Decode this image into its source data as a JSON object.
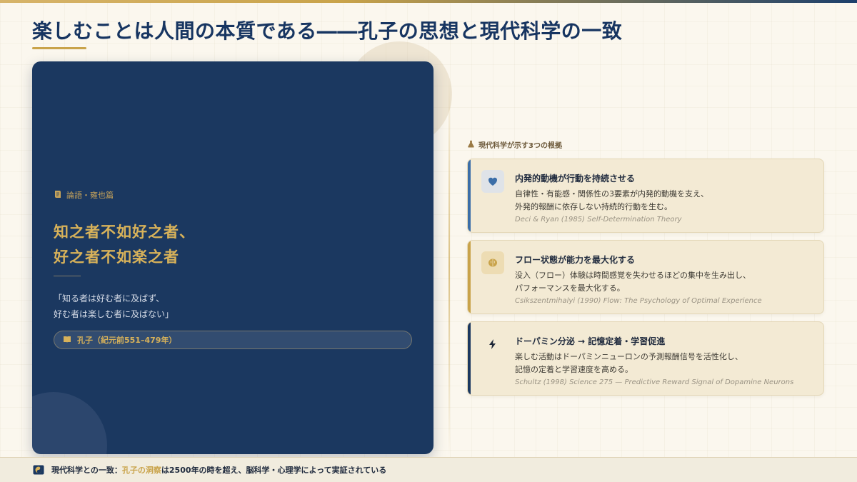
{
  "title": "楽しむことは人間の本質である――孔子の思想と現代科学の一致",
  "quote_card": {
    "source": "論語・雍也篇",
    "quote_line1": "知之者不如好之者、",
    "quote_line2": "好之者不如楽之者",
    "translation_line1": "「知る者は好む者に及ばず、",
    "translation_line2": "好む者は楽しむ者に及ばない」",
    "author": "孔子（紀元前551–479年）"
  },
  "evidence": {
    "header": "現代科学が示す3つの根拠",
    "cards": [
      {
        "icon": "heart-icon",
        "title": "内発的動機が行動を持続させる",
        "body_line1": "自律性・有能感・関係性の3要素が内発的動機を支え、",
        "body_line2": "外発的報酬に依存しない持続的行動を生む。",
        "citation": "Deci & Ryan (1985) Self-Determination Theory",
        "accent": "#3b6ea8"
      },
      {
        "icon": "brain-icon",
        "title": "フロー状態が能力を最大化する",
        "body_line1": "没入（フロー）体験は時間感覚を失わせるほどの集中を生み出し、",
        "body_line2": "パフォーマンスを最大化する。",
        "citation": "Csikszentmihalyi (1990) Flow: The Psychology of Optimal Experience",
        "accent": "#c9a34a"
      },
      {
        "icon": "lightning-icon",
        "title": "ドーパミン分泌 → 記憶定着・学習促進",
        "body_line1": "楽しむ活動はドーパミンニューロンの予測報酬信号を活性化し、",
        "body_line2": "記憶の定着と学習速度を高める。",
        "citation": "Schultz (1998) Science 275 — Predictive Reward Signal of Dopamine Neurons",
        "accent": "#1b3860"
      }
    ]
  },
  "footer": {
    "prefix": "現代科学との一致：",
    "highlight": "孔子の洞察",
    "suffix": "は2500年の時を超え、脳科学・心理学によって実証されている"
  },
  "colors": {
    "navy": "#1b3860",
    "gold": "#c9a34a",
    "background": "#fbf7ee",
    "card": "#f3ead4"
  }
}
